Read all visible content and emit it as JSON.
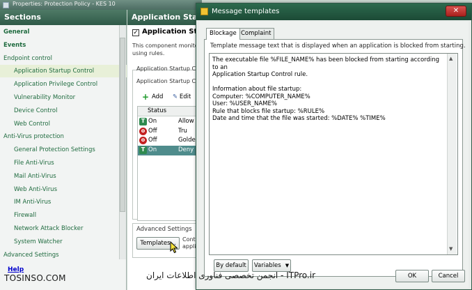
{
  "background_window": {
    "title": "Properties: Protection Policy - KES 10"
  },
  "sidebar": {
    "header": "Sections",
    "items": [
      {
        "label": "General",
        "level": "bold"
      },
      {
        "label": "Events",
        "level": "bold"
      },
      {
        "label": "Endpoint control",
        "level": "group"
      },
      {
        "label": "Application Startup Control",
        "level": "sub",
        "selected": true
      },
      {
        "label": "Application Privilege Control",
        "level": "sub"
      },
      {
        "label": "Vulnerability Monitor",
        "level": "sub"
      },
      {
        "label": "Device Control",
        "level": "sub"
      },
      {
        "label": "Web Control",
        "level": "sub"
      },
      {
        "label": "Anti-Virus protection",
        "level": "group"
      },
      {
        "label": "General Protection Settings",
        "level": "sub"
      },
      {
        "label": "File Anti-Virus",
        "level": "sub"
      },
      {
        "label": "Mail Anti-Virus",
        "level": "sub"
      },
      {
        "label": "Web Anti-Virus",
        "level": "sub"
      },
      {
        "label": "IM Anti-Virus",
        "level": "sub"
      },
      {
        "label": "Firewall",
        "level": "sub"
      },
      {
        "label": "Network Attack Blocker",
        "level": "sub"
      },
      {
        "label": "System Watcher",
        "level": "sub"
      },
      {
        "label": "Advanced Settings",
        "level": "group"
      }
    ],
    "help_link": "Help"
  },
  "main_panel": {
    "header": "Application Start",
    "enable_checkbox_label": "Application Star",
    "description_line1": "This component monitors",
    "description_line2": "using rules.",
    "group_label": "Application Startup Co",
    "rules_label": "Application Startup Co",
    "toolbar": {
      "add_label": "Add",
      "edit_label": "Edit"
    },
    "table": {
      "columns": [
        "Status"
      ],
      "rows": [
        {
          "status": "On",
          "state": "on",
          "rule": "Allow a"
        },
        {
          "status": "Off",
          "state": "off",
          "rule": "Tru"
        },
        {
          "status": "Off",
          "state": "off",
          "rule": "Golder"
        },
        {
          "status": "On",
          "state": "on",
          "rule": "Deny",
          "selected": true
        }
      ]
    },
    "advanced_settings_label": "Advanced Settings",
    "templates_button": "Templates...",
    "templates_desc_line1": "Cont",
    "templates_desc_line2": "appli"
  },
  "dialog": {
    "title": "Message templates",
    "close_label": "✕",
    "tabs": [
      {
        "label": "Blockage",
        "active": true
      },
      {
        "label": "Complaint",
        "active": false
      }
    ],
    "description": "Template message text that is displayed when an application is blocked from starting.",
    "template_text": "The executable file %FILE_NAME% has been blocked from starting according to an\nApplication Startup Control rule.\n\nInformation about file startup:\nComputer: %COMPUTER_NAME%\nUser: %USER_NAME%\nRule that blocks file startup: %RULE%\nDate and time that the file was started: %DATE% %TIME%",
    "by_default_button": "By default",
    "variables_button": "Variables",
    "ok_button": "OK",
    "cancel_button": "Cancel"
  },
  "watermark": {
    "left_text": "TOSINSO.COM",
    "right_text": "ITPro.ir - انجمن تخصصی فناوری اطلاعات ایران"
  },
  "colors": {
    "header_green": "#2f5a48",
    "sidebar_text": "#1f6b3f",
    "selection_teal": "#4f8c8c"
  }
}
